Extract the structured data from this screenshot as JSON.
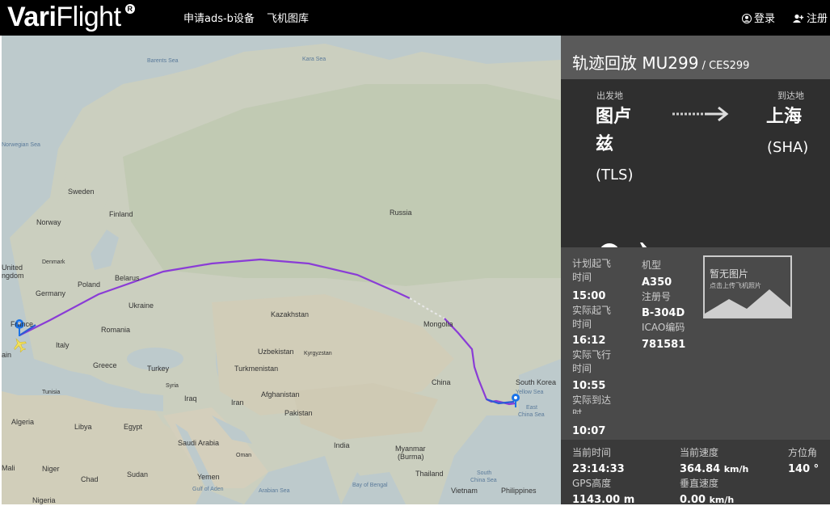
{
  "header": {
    "logo_bold": "Vari",
    "logo_light": "Flight",
    "logo_mark": "R",
    "nav": [
      "申请ads-b设备",
      "飞机图库"
    ],
    "login": "登录",
    "register": "注册"
  },
  "map": {
    "labels": {
      "barents": "Barents Sea",
      "kara": "Kara Sea",
      "norwegian": "Norwegian Sea",
      "sweden": "Sweden",
      "finland": "Finland",
      "norway": "Norway",
      "denmark": "Denmark",
      "united": "United",
      "kingdom": "ngdom",
      "germany": "Germany",
      "poland": "Poland",
      "belarus": "Belarus",
      "ukraine": "Ukraine",
      "france": "France",
      "romania": "Romania",
      "italy": "Italy",
      "spain": "ain",
      "greece": "Greece",
      "turkey": "Turkey",
      "tunisia": "Tunisia",
      "algeria": "Algeria",
      "libya": "Libya",
      "egypt": "Egypt",
      "syria": "Syria",
      "iraq": "Iraq",
      "iran": "Iran",
      "saudi": "Saudi Arabia",
      "oman": "Oman",
      "yemen": "Yemen",
      "gulf_aden": "Gulf of Aden",
      "sudan": "Sudan",
      "chad": "Chad",
      "niger": "Niger",
      "mali": "Mali",
      "nigeria": "Nigeria",
      "russia": "Russia",
      "kazakhstan": "Kazakhstan",
      "uzbekistan": "Uzbekistan",
      "kyrgyzstan": "Kyrgyzstan",
      "turkmenistan": "Turkmenistan",
      "afghanistan": "Afghanistan",
      "pakistan": "Pakistan",
      "india": "India",
      "mongolia": "Mongolia",
      "china": "China",
      "south_korea": "South Korea",
      "yellow_sea": "Yellow Sea",
      "east_china_sea1": "East",
      "east_china_sea2": "China Sea",
      "myanmar1": "Myanmar",
      "myanmar2": "(Burma)",
      "thailand": "Thailand",
      "vietnam": "Vietnam",
      "philippines": "Philippines",
      "bay_bengal": "Bay of Bengal",
      "arabian_sea": "Arabian Sea",
      "south_china_sea": "South",
      "south_china_sea2": "China Sea"
    }
  },
  "panel": {
    "title": "轨迹回放 MU299",
    "title_sub": " / CES299",
    "dep_label": "出发地",
    "arr_label": "到达地",
    "dep_city_1": "图卢",
    "dep_city_2": "兹",
    "dep_code": "(TLS)",
    "arr_city": "上海",
    "arr_code": "(SHA)",
    "sched_dep_label_1": "计划起飞",
    "sched_dep_label_2": "时间",
    "sched_dep": "15:00",
    "actual_dep_label_1": "实际起飞",
    "actual_dep_label_2": "时间",
    "actual_dep": "16:12",
    "actual_fly_label_1": "实际飞行",
    "actual_fly_label_2": "时间",
    "actual_fly": "10:55",
    "actual_arr_label_1": "实际到达",
    "actual_arr_label_2": "时",
    "actual_arr": "10:07",
    "type_label": "机型",
    "type": "A350",
    "reg_label": "注册号",
    "reg": "B-304D",
    "icao_label": "ICAO编码",
    "icao": "781581",
    "no_photo": "暂无图片",
    "no_photo_sub": "点击上传飞机照片",
    "cur_time_label": "当前时间",
    "cur_time": "23:14:33",
    "cur_speed_label": "当前速度",
    "cur_speed": "364.84",
    "speed_unit": "km/h",
    "heading_label": "方位角",
    "heading": "140 °",
    "gps_label": "GPS高度",
    "gps": "1143.00 m",
    "vspeed_label": "垂直速度",
    "vspeed": "0.00",
    "vspeed_unit": "km/h"
  }
}
